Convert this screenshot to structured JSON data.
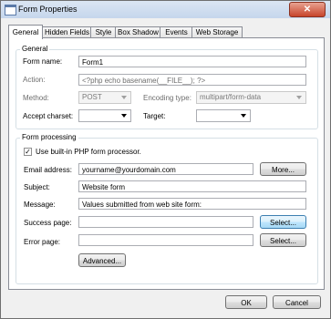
{
  "window": {
    "title": "Form Properties",
    "close_label": "✕"
  },
  "tabs": [
    {
      "label": "General"
    },
    {
      "label": "Hidden Fields"
    },
    {
      "label": "Style"
    },
    {
      "label": "Box Shadow"
    },
    {
      "label": "Events"
    },
    {
      "label": "Web Storage"
    }
  ],
  "general": {
    "group_label": "General",
    "form_name_label": "Form name:",
    "form_name_value": "Form1",
    "action_label": "Action:",
    "action_value": "<?php echo basename(__FILE__); ?>",
    "method_label": "Method:",
    "method_value": "POST",
    "encoding_label": "Encoding type:",
    "encoding_value": "multipart/form-data",
    "accept_charset_label": "Accept charset:",
    "accept_charset_value": "",
    "target_label": "Target:",
    "target_value": ""
  },
  "processing": {
    "group_label": "Form processing",
    "use_builtin_label": "Use built-in PHP form processor.",
    "use_builtin_checked": "✓",
    "email_label": "Email address:",
    "email_value": "yourname@yourdomain.com",
    "more_label": "More...",
    "subject_label": "Subject:",
    "subject_value": "Website form",
    "message_label": "Message:",
    "message_value": "Values submitted from web site form:",
    "success_label": "Success page:",
    "success_value": "",
    "error_label": "Error page:",
    "error_value": "",
    "select_label": "Select...",
    "advanced_label": "Advanced..."
  },
  "footer": {
    "ok_label": "OK",
    "cancel_label": "Cancel"
  }
}
